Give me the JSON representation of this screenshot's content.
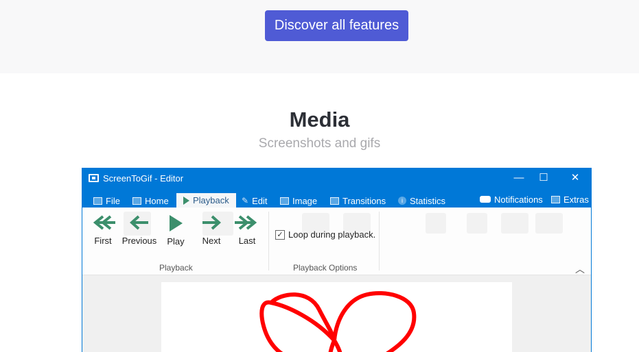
{
  "hero": {
    "cta_label": "Discover all features"
  },
  "section": {
    "title": "Media",
    "subtitle": "Screenshots and gifs"
  },
  "window": {
    "title": "ScreenToGif - Editor",
    "controls": {
      "minimize": "—",
      "maximize": "☐",
      "close": "✕"
    },
    "tabs": [
      {
        "label": "File",
        "icon": "save-icon"
      },
      {
        "label": "Home",
        "icon": "home-icon"
      },
      {
        "label": "Playback",
        "icon": "play-icon",
        "active": true
      },
      {
        "label": "Edit",
        "icon": "pencil-icon"
      },
      {
        "label": "Image",
        "icon": "image-icon"
      },
      {
        "label": "Transitions",
        "icon": "transitions-icon"
      },
      {
        "label": "Statistics",
        "icon": "info-icon"
      }
    ],
    "right_tabs": [
      {
        "label": "Notifications",
        "icon": "notification-icon"
      },
      {
        "label": "Extras",
        "icon": "extras-icon"
      }
    ],
    "playback_buttons": [
      {
        "label": "First",
        "icon": "first-frame-icon"
      },
      {
        "label": "Previous",
        "icon": "previous-frame-icon"
      },
      {
        "label": "Play",
        "icon": "play-icon"
      },
      {
        "label": "Next",
        "icon": "next-frame-icon"
      },
      {
        "label": "Last",
        "icon": "last-frame-icon"
      }
    ],
    "group_playback": "Playback",
    "loop_label": "Loop during playback.",
    "loop_checked": true,
    "group_playback_options": "Playback Options",
    "accent_color": "#0078d7",
    "playback_icon_color": "#3c8f6c",
    "heart_color": "#ff0000"
  }
}
